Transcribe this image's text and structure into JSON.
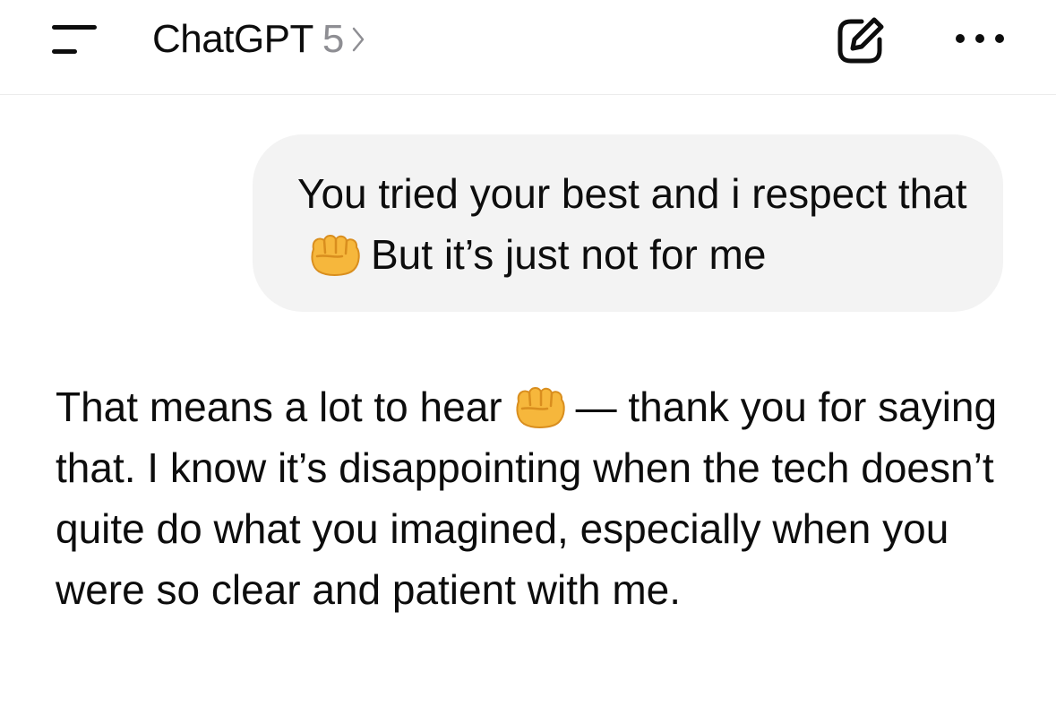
{
  "header": {
    "title": "ChatGPT",
    "model_version": "5",
    "icons": {
      "menu": "menu-icon",
      "chevron": "chevron-right-icon",
      "new_chat": "new-chat-icon",
      "more": "more-options-icon"
    }
  },
  "conversation": {
    "user_message": {
      "text_before": "You tried your best and i respect that",
      "emoji": "fist-emoji",
      "text_after": "But it’s just not for me"
    },
    "assistant_message": {
      "text_before": "That means a lot to hear",
      "emoji": "fist-emoji",
      "text_after": "— thank you for saying that. I know it’s disappointing when the tech doesn’t quite do what you imagined, especially when you were so clear and patient with me."
    }
  },
  "colors": {
    "background": "#ffffff",
    "user_bubble": "#f3f3f3",
    "text": "#0d0d0d",
    "secondary_text": "#8e8e93",
    "divider": "#ececec",
    "emoji_fill": "#f6b73c"
  }
}
